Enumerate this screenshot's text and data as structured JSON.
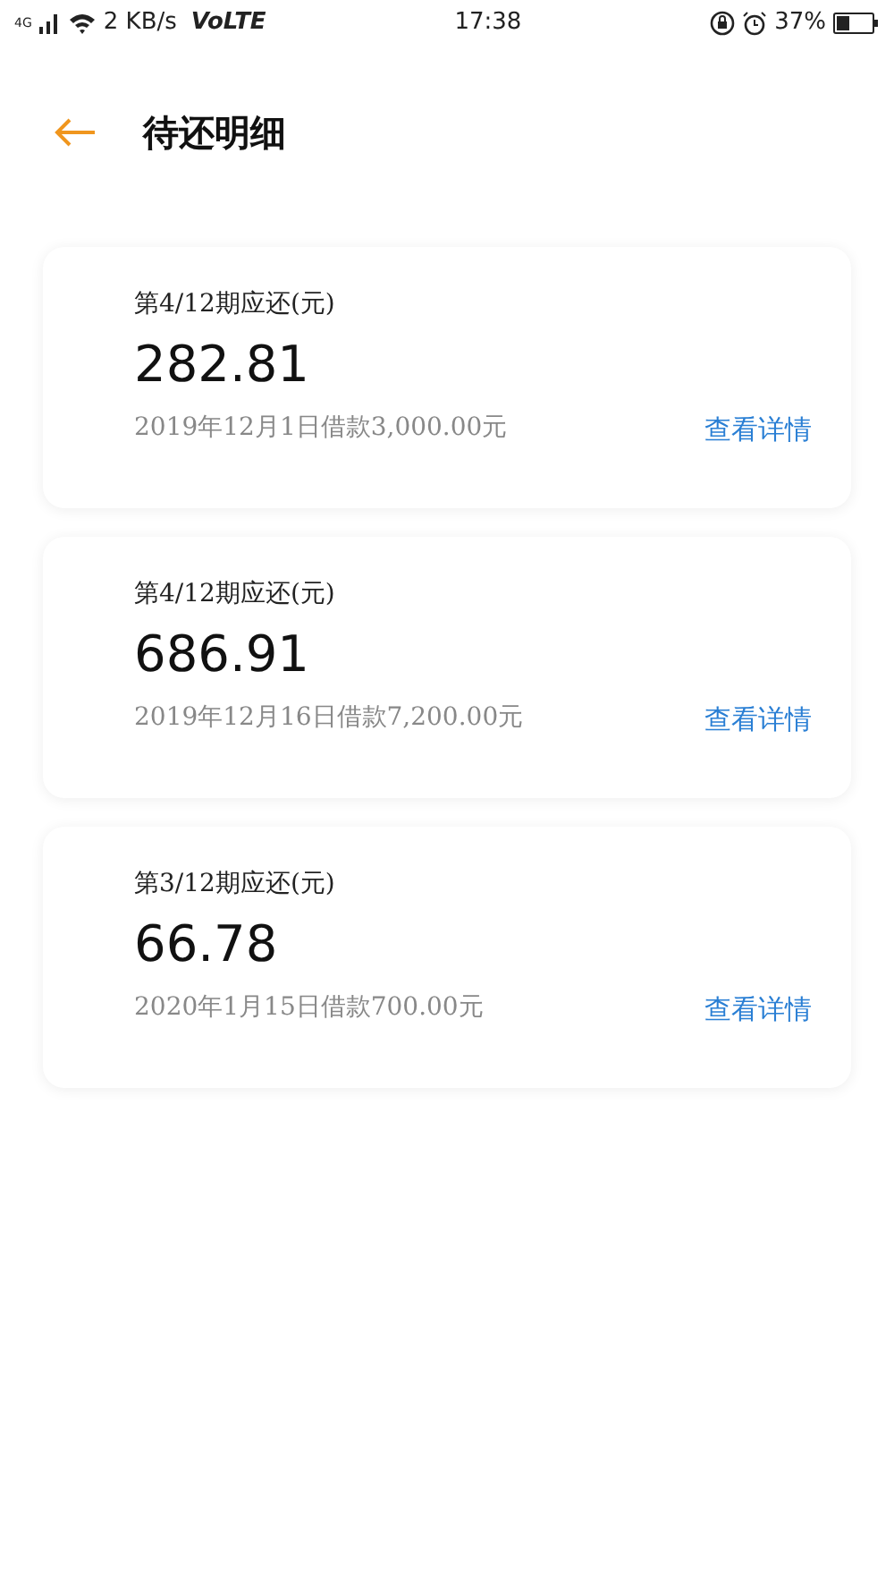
{
  "status_bar": {
    "network": "4G",
    "speed": "2 KB/s",
    "volte": "VoLTE",
    "time": "17:38",
    "battery": "37%"
  },
  "header": {
    "title": "待还明细"
  },
  "loans": [
    {
      "period": "第4/12期应还(元)",
      "amount": "282.81",
      "loan_info": "2019年12月1日借款3,000.00元",
      "link": "查看详情"
    },
    {
      "period": "第4/12期应还(元)",
      "amount": "686.91",
      "loan_info": "2019年12月16日借款7,200.00元",
      "link": "查看详情"
    },
    {
      "period": "第3/12期应还(元)",
      "amount": "66.78",
      "loan_info": "2020年1月15日借款700.00元",
      "link": "查看详情"
    }
  ]
}
